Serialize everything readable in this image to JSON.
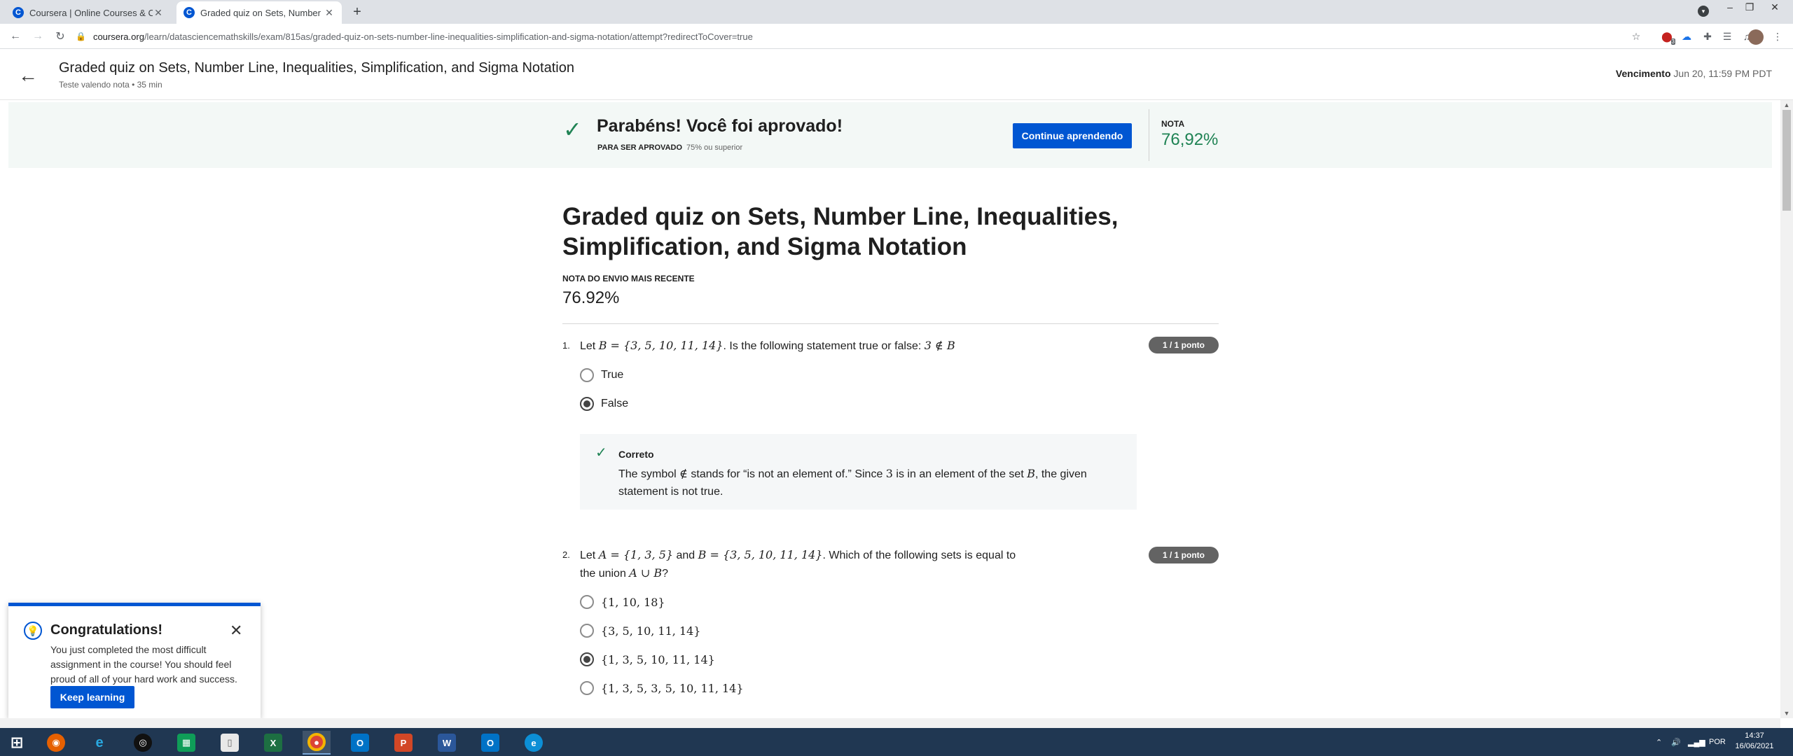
{
  "browser": {
    "tabs": [
      {
        "title": "Coursera | Online Courses & Credentials",
        "favicon": "C",
        "active": false
      },
      {
        "title": "Graded quiz on Sets, Number Line, Inequalities",
        "favicon": "C",
        "active": true
      }
    ],
    "new_tab": "+",
    "url_host": "coursera.org",
    "url_path": "/learn/datasciencemathskills/exam/815as/graded-quiz-on-sets-number-line-inequalities-simplification-and-sigma-notation/attempt?redirectToCover=true",
    "extension_badge": "3"
  },
  "header": {
    "title": "Graded quiz on Sets, Number Line, Inequalities, Simplification, and Sigma Notation",
    "subtitle": "Teste valendo nota • 35 min",
    "due_label": "Vencimento",
    "due_value": "Jun 20, 11:59 PM PDT"
  },
  "banner": {
    "title": "Parabéns! Você foi aprovado!",
    "pass_label": "PARA SER APROVADO",
    "pass_value": "75% ou superior",
    "continue_label": "Continue aprendendo",
    "grade_label": "NOTA",
    "grade_value": "76,92%"
  },
  "main": {
    "title": "Graded quiz on Sets, Number Line, Inequalities, Simplification, and Sigma Notation",
    "recent_label": "NOTA DO ENVIO MAIS RECENTE",
    "recent_value": "76.92%"
  },
  "questions": [
    {
      "number": "1.",
      "text_prefix": "Let ",
      "text_math": "B = {3, 5, 10, 11, 14}",
      "text_mid": ". Is the following statement true or false: ",
      "text_math2": "3 ∉ B",
      "score": "1 / 1 ponto",
      "options": [
        {
          "label": "True",
          "selected": false
        },
        {
          "label": "False",
          "selected": true
        }
      ],
      "feedback": {
        "label": "Correto",
        "text_a": "The symbol ",
        "math_a": "∉",
        "text_b": " stands for “is not an element of.” Since ",
        "math_b": "3",
        "text_c": " is in an element of the set ",
        "math_c": "B",
        "text_d": ", the given statement is not true."
      }
    },
    {
      "number": "2.",
      "text_prefix": "Let ",
      "text_math": "A = {1, 3, 5}",
      "text_mid": " and ",
      "text_math2": "B = {3, 5, 10, 11, 14}",
      "text_after": ". Which of the following sets is equal to the union ",
      "text_math3": "A ∪ B",
      "text_end": "?",
      "score": "1 / 1 ponto",
      "options": [
        {
          "label": "{1, 10, 18}",
          "selected": false
        },
        {
          "label": "{3, 5, 10, 11, 14}",
          "selected": false
        },
        {
          "label": "{1, 3, 5, 10, 11, 14}",
          "selected": true
        },
        {
          "label": "{1, 3, 5, 3, 5, 10, 11, 14}",
          "selected": false
        }
      ]
    }
  ],
  "toast": {
    "title": "Congratulations!",
    "body": "You just completed the most difficult assignment in the course! You should feel proud of all of your hard work and success.",
    "button": "Keep learning"
  },
  "taskbar": {
    "apps": [
      "windows-start",
      "firefox",
      "internet-explorer",
      "obs",
      "sheets",
      "file",
      "excel",
      "chrome",
      "outlook",
      "powerpoint",
      "word",
      "outlook-2",
      "edge"
    ],
    "language": "POR",
    "time": "14:37",
    "date": "16/06/2021"
  },
  "colors": {
    "brand_blue": "#0056d2",
    "success_green": "#1f8354",
    "taskbar": "#203752"
  }
}
